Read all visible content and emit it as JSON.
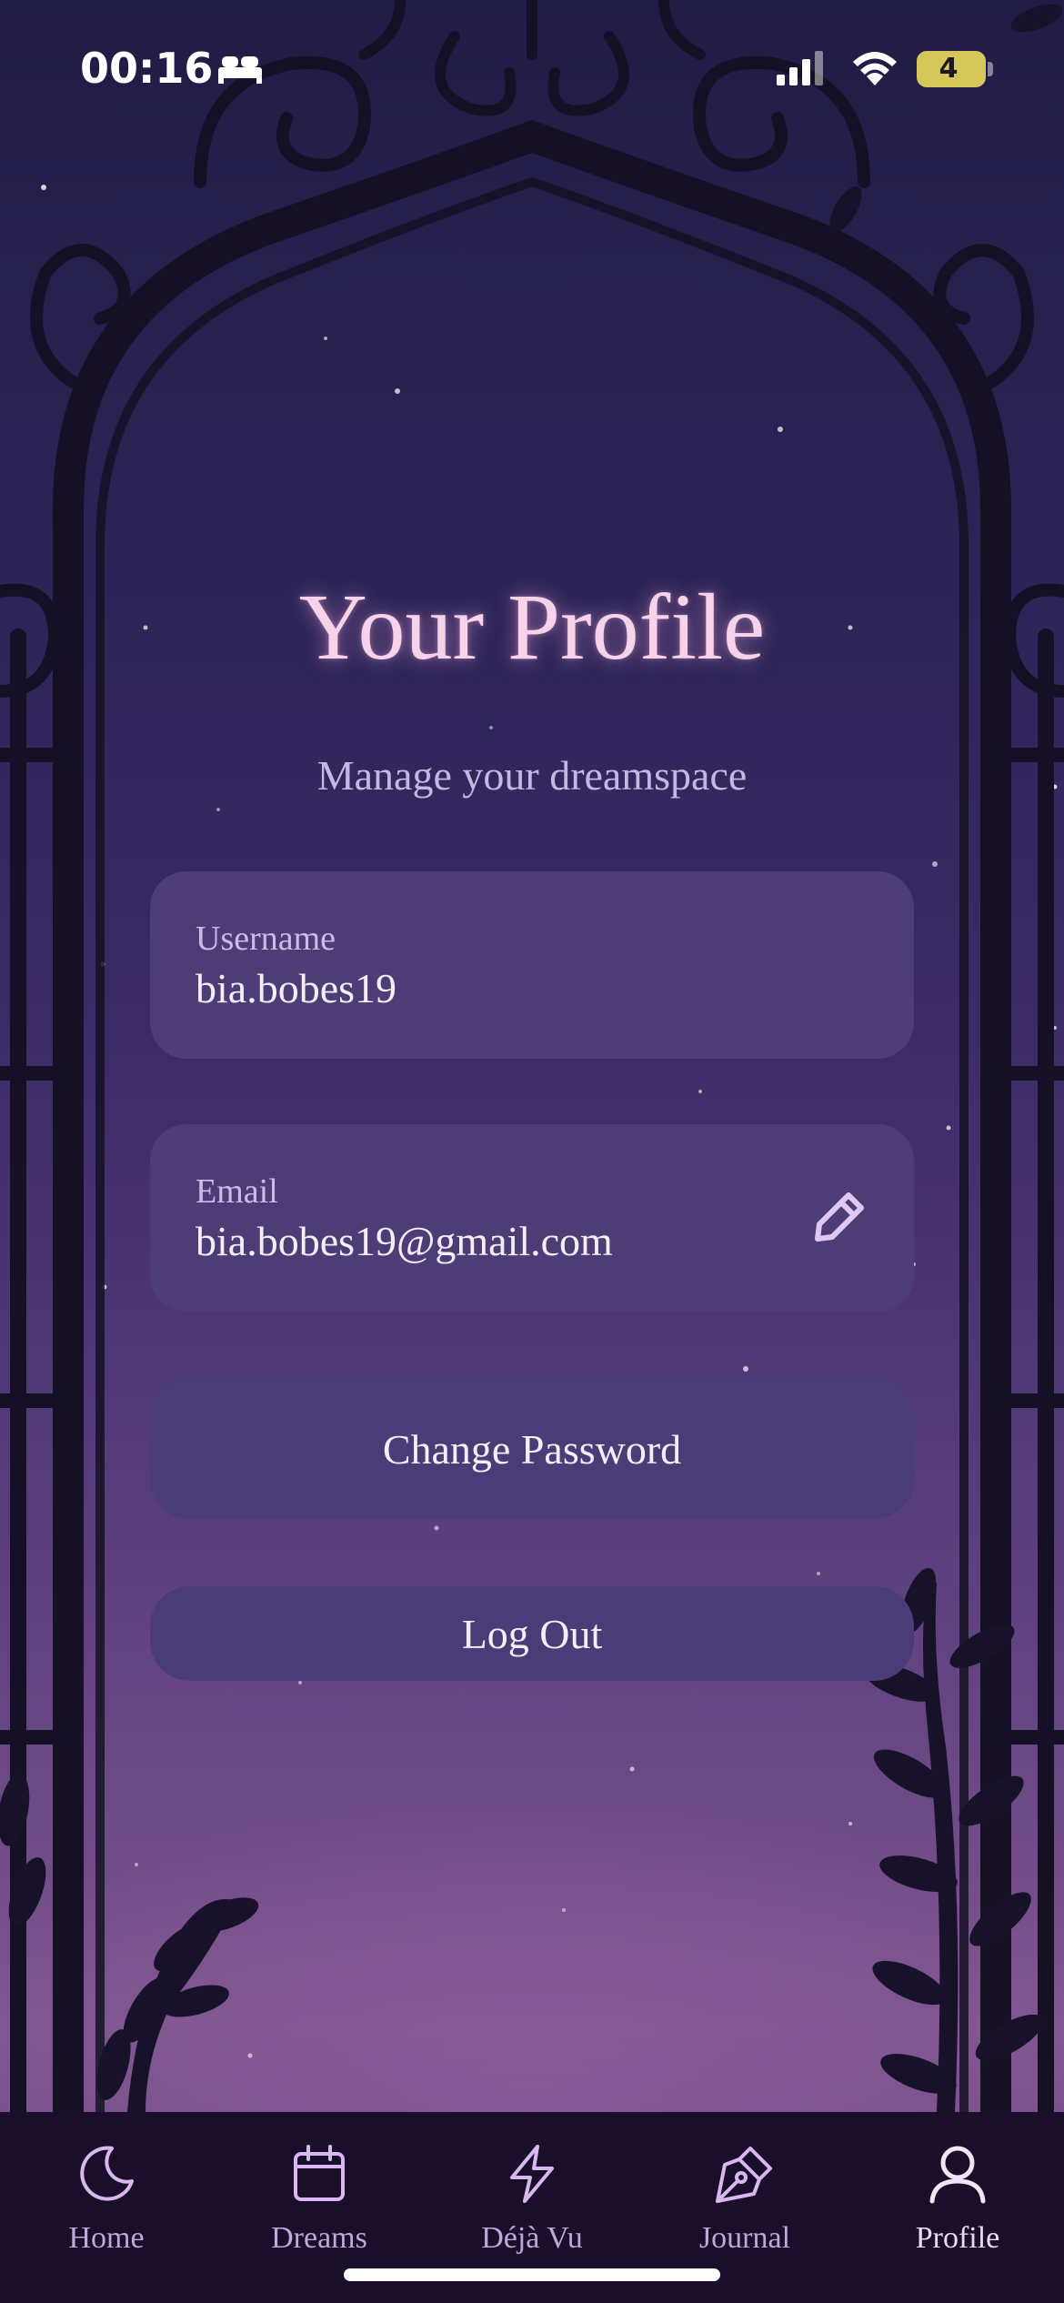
{
  "status_bar": {
    "time": "00:16",
    "battery": "4"
  },
  "page": {
    "title": "Your Profile",
    "subtitle": "Manage your dreamspace"
  },
  "fields": {
    "username": {
      "label": "Username",
      "value": "bia.bobes19"
    },
    "email": {
      "label": "Email",
      "value": "bia.bobes19@gmail.com"
    }
  },
  "buttons": {
    "change_password": "Change Password",
    "log_out": "Log Out"
  },
  "tabs": [
    {
      "label": "Home",
      "icon": "moon-icon"
    },
    {
      "label": "Dreams",
      "icon": "calendar-icon"
    },
    {
      "label": "Déjà Vu",
      "icon": "lightning-icon"
    },
    {
      "label": "Journal",
      "icon": "pen-nib-icon"
    },
    {
      "label": "Profile",
      "icon": "user-icon",
      "active": true
    }
  ],
  "colors": {
    "title": "#f6d3ea",
    "field_bg": "#4d3d77",
    "tabbar_bg": "#190f2b",
    "accent": "#d9b8f0"
  }
}
